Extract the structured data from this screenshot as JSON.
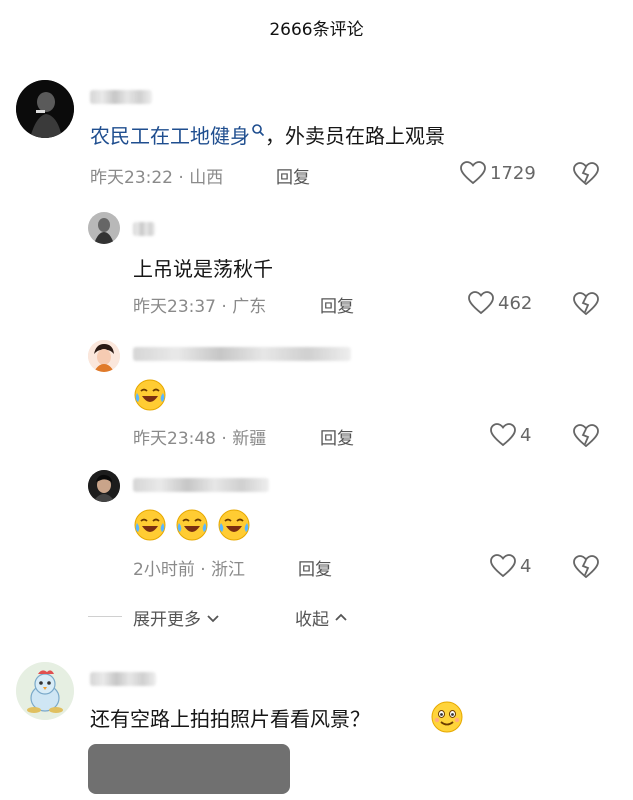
{
  "header": {
    "title": "2666条评论"
  },
  "comments": [
    {
      "text_link": "农民工在工地健身",
      "text_rest": "，外卖员在路上观景",
      "time": "昨天23:22",
      "location": "山西",
      "reply_label": "回复",
      "likes": "1729"
    }
  ],
  "replies": [
    {
      "text": "上吊说是荡秋千",
      "time": "昨天23:37",
      "location": "广东",
      "reply_label": "回复",
      "likes": "462"
    },
    {
      "time": "昨天23:48",
      "location": "新疆",
      "reply_label": "回复",
      "likes": "4"
    },
    {
      "time": "2小时前",
      "location": "浙江",
      "reply_label": "回复",
      "likes": "4"
    }
  ],
  "expand": {
    "more_label": "展开更多",
    "collapse_label": "收起"
  },
  "comment2": {
    "text": "还有空路上拍拍照片看看风景？"
  },
  "colors": {
    "link": "#1f4e8f",
    "meta": "#8a8a8a"
  }
}
